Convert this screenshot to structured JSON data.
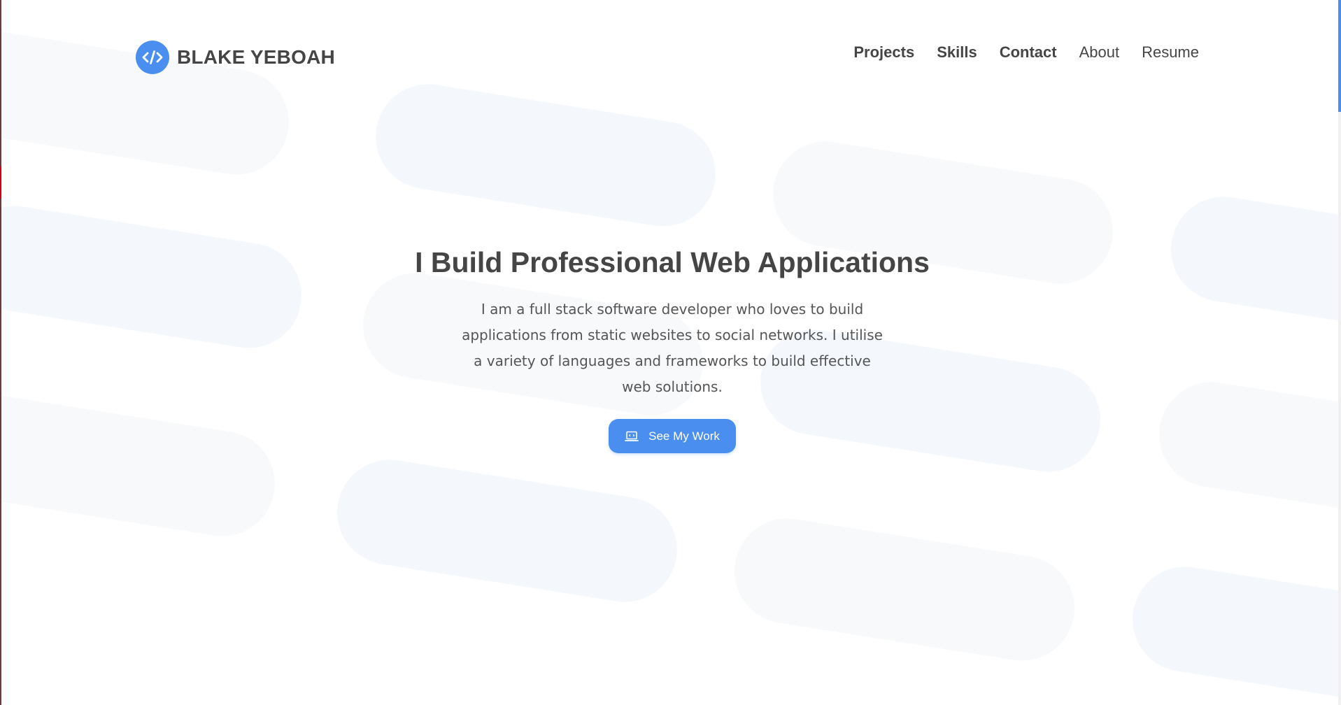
{
  "brand": {
    "name": "BLAKE YEBOAH",
    "logo_icon": "code-icon",
    "accent_color": "#4a8ef0"
  },
  "nav": {
    "items": [
      {
        "label": "Projects"
      },
      {
        "label": "Skills"
      },
      {
        "label": "Contact"
      },
      {
        "label": "About"
      },
      {
        "label": "Resume"
      }
    ]
  },
  "hero": {
    "title": "I Build Professional Web Applications",
    "description": "I am a full stack software developer who loves to build applications from static websites to social networks. I utilise a variety of languages and frameworks to build effective web solutions.",
    "cta_label": "See My Work",
    "cta_icon": "laptop-icon"
  }
}
